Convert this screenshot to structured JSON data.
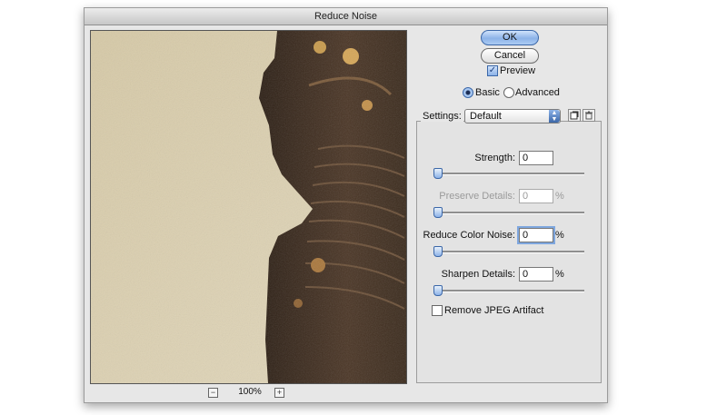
{
  "window": {
    "title": "Reduce Noise"
  },
  "buttons": {
    "ok": "OK",
    "cancel": "Cancel"
  },
  "preview_toggle": {
    "label": "Preview",
    "checked": true
  },
  "mode": {
    "basic": "Basic",
    "advanced": "Advanced",
    "selected": "basic"
  },
  "settings": {
    "label": "Settings:",
    "value": "Default"
  },
  "controls": {
    "strength": {
      "label": "Strength:",
      "value": "0",
      "unit": ""
    },
    "preserve": {
      "label": "Preserve Details:",
      "value": "0",
      "unit": "%"
    },
    "color_noise": {
      "label": "Reduce Color Noise:",
      "value": "0",
      "unit": "%"
    },
    "sharpen": {
      "label": "Sharpen Details:",
      "value": "0",
      "unit": "%"
    }
  },
  "jpeg_artifact": {
    "label": "Remove JPEG Artifact",
    "checked": false
  },
  "zoom": {
    "level": "100%",
    "minus": "−",
    "plus": "+"
  },
  "colors": {
    "accent": "#8db3e8",
    "panel": "#e3e3e3",
    "background": "#d8cdb0",
    "statue": "#3a2a1c"
  },
  "icons": {
    "save_preset": "save-preset-icon",
    "delete_preset": "trash-icon",
    "dropdown": "chevron-updown-icon",
    "check": "checkmark-icon"
  }
}
